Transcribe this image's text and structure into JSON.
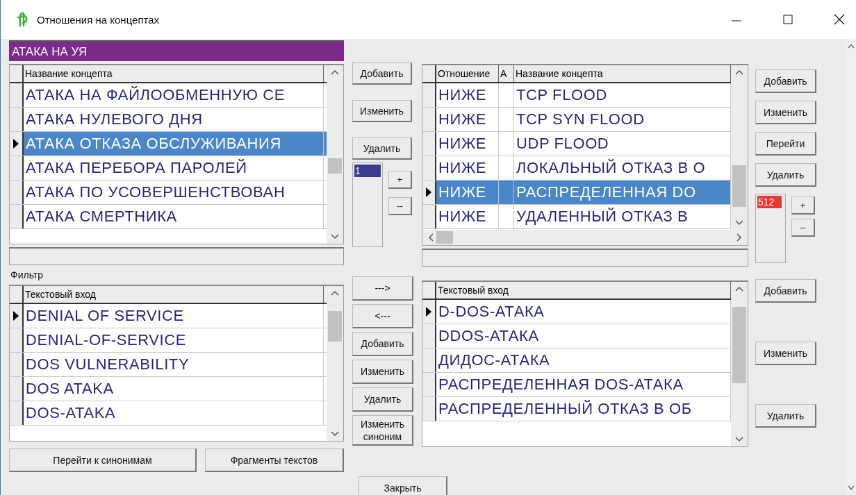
{
  "window": {
    "title": "Отношения на концептах"
  },
  "concept_bar": "АТАКА НА УЯ",
  "concepts": {
    "columns": [
      "Название концепта"
    ],
    "rows": [
      {
        "cells": [
          "АТАКА НА ФАЙЛООБМЕННУЮ СЕ"
        ],
        "selected": false,
        "current": false
      },
      {
        "cells": [
          "АТАКА НУЛЕВОГО ДНЯ"
        ],
        "selected": false,
        "current": false
      },
      {
        "cells": [
          "АТАКА ОТКАЗА ОБСЛУЖИВАНИЯ"
        ],
        "selected": true,
        "current": true
      },
      {
        "cells": [
          "АТАКА ПЕРЕБОРА ПАРОЛЕЙ"
        ],
        "selected": false,
        "current": false
      },
      {
        "cells": [
          "АТАКА ПО УСОВЕРШЕНСТВОВАН"
        ],
        "selected": false,
        "current": false
      },
      {
        "cells": [
          "АТАКА СМЕРТНИКА"
        ],
        "selected": false,
        "current": false
      }
    ]
  },
  "concept_buttons": [
    "Добавить",
    "Изменить",
    "Удалить"
  ],
  "level_list": {
    "items": [
      {
        "label": "1",
        "selected": true
      }
    ],
    "plus": "+",
    "minus": "--"
  },
  "relations": {
    "columns": [
      "Отношение",
      "А",
      "Название концепта"
    ],
    "rows": [
      {
        "cells": [
          "НИЖЕ",
          "",
          "TCP FLOOD"
        ],
        "selected": false,
        "current": false
      },
      {
        "cells": [
          "НИЖЕ",
          "",
          "TCP SYN FLOOD"
        ],
        "selected": false,
        "current": false
      },
      {
        "cells": [
          "НИЖЕ",
          "",
          "UDP FLOOD"
        ],
        "selected": false,
        "current": false
      },
      {
        "cells": [
          "НИЖЕ",
          "",
          "ЛОКАЛЬНЫЙ ОТКАЗ В О"
        ],
        "selected": false,
        "current": false
      },
      {
        "cells": [
          "НИЖЕ",
          "",
          "РАСПРЕДЕЛЕННАЯ DO"
        ],
        "selected": true,
        "current": true
      },
      {
        "cells": [
          "НИЖЕ",
          "",
          "УДАЛЕННЫЙ ОТКАЗ В"
        ],
        "selected": false,
        "current": false
      }
    ]
  },
  "relation_buttons": [
    "Добавить",
    "Изменить",
    "Перейти",
    "Удалить"
  ],
  "count_list": {
    "items": [
      {
        "label": "512",
        "selected": true
      }
    ],
    "plus": "+",
    "minus": "--"
  },
  "filter_label": "Фильтр",
  "synonyms": {
    "columns": [
      "Текстовый вход"
    ],
    "rows": [
      {
        "cells": [
          "DENIAL OF SERVICE"
        ],
        "selected": false,
        "current": true
      },
      {
        "cells": [
          "DENIAL-OF-SERVICE"
        ],
        "selected": false,
        "current": false
      },
      {
        "cells": [
          "DOS VULNERABILITY"
        ],
        "selected": false,
        "current": false
      },
      {
        "cells": [
          "DOS ATAKA"
        ],
        "selected": false,
        "current": false
      },
      {
        "cells": [
          "DOS-ATAKA"
        ],
        "selected": false,
        "current": false
      }
    ]
  },
  "transfer_buttons": [
    "--->",
    "<---"
  ],
  "synonym_buttons": [
    "Добавить",
    "Изменить",
    "Удалить",
    "Изменить синоним"
  ],
  "text_inputs": {
    "columns": [
      "Текстовый вход"
    ],
    "rows": [
      {
        "cells": [
          "D-DOS-АТАКА"
        ],
        "selected": false,
        "current": true
      },
      {
        "cells": [
          "DDOS-АТАКА"
        ],
        "selected": false,
        "current": false
      },
      {
        "cells": [
          "ДИДОС-АТАКА"
        ],
        "selected": false,
        "current": false
      },
      {
        "cells": [
          "РАСПРЕДЕЛЕННАЯ DOS-АТАКА"
        ],
        "selected": false,
        "current": false
      },
      {
        "cells": [
          "РАСПРЕДЕЛЕННЫЙ ОТКАЗ В ОБ"
        ],
        "selected": false,
        "current": false
      }
    ]
  },
  "text_input_buttons": [
    "Добавить",
    "Изменить",
    "Удалить"
  ],
  "bottom_buttons": [
    "Перейти к синонимам",
    "Фрагменты текстов"
  ],
  "close_button": "Закрыть"
}
